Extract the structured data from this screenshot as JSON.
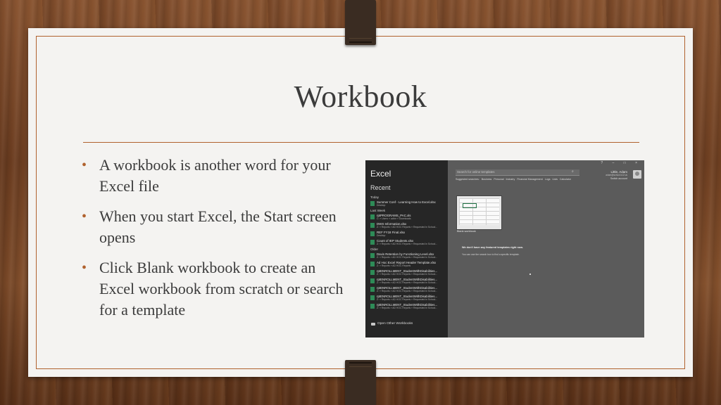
{
  "slide": {
    "title": "Workbook",
    "bullets": [
      "A workbook is another word for your Excel file",
      "When you start Excel, the Start screen opens",
      "Click Blank workbook to create an Excel workbook from scratch or search for a template"
    ],
    "accent_color": "#b0622e"
  },
  "excel": {
    "app_title": "Excel",
    "recent_label": "Recent",
    "groups": [
      {
        "label": "Today",
        "files": [
          {
            "name": "Summer Conf - Learning How to Excel.xlsx",
            "path": "Desktop"
          }
        ]
      },
      {
        "label": "Last Week",
        "files": [
          {
            "name": "rptPROGRAMS_PAC.xls",
            "path": "C: » Users » ucthe » Downloads"
          },
          {
            "name": "DWS Information.xlsx",
            "path": "Z: » Reports » AD HOC Reports » Requested in School..."
          },
          {
            "name": "REF FY18 Final.xlsx",
            "path": "Desktop"
          },
          {
            "name": "Count of IEP Students.xlsx",
            "path": "Z: » Reports » AD HOC Reports » Requested in School..."
          }
        ]
      },
      {
        "label": "Older",
        "files": [
          {
            "name": "Davis Retention by Functioning Level.xlsx",
            "path": "Z: » Reports » AD HOC Reports » Requested in School..."
          },
          {
            "name": "Ad Hoc Excel Report Header Template.xlsx",
            "path": "Z: » Reports » AD HOC Reports"
          },
          {
            "name": "rptENROLLMENT_StudentWithDisabilities...",
            "path": "Z: » Reports » AD HOC Reports » Requested in School..."
          },
          {
            "name": "rptENROLLMENT_StudentWithDisabilities...",
            "path": "Z: » Reports » AD HOC Reports » Requested in School..."
          },
          {
            "name": "rptENROLLMENT_StudentWithDisabilities...",
            "path": "Z: » Reports » AD HOC Reports » Requested in School..."
          },
          {
            "name": "rptENROLLMENT_StudentWithDisabilities...",
            "path": "Z: » Reports » AD HOC Reports » Requested in School..."
          },
          {
            "name": "rptENROLLMENT_StudentWithDisabilities...",
            "path": "Z: » Reports » AD HOC Reports » Requested in School..."
          }
        ]
      }
    ],
    "open_other": "Open Other Workbooks",
    "window_controls": "? – □ ×",
    "search_placeholder": "Search for online templates",
    "search_icon": "search-icon",
    "suggested": [
      "Suggested searches:",
      "Business",
      "Personal",
      "Industry",
      "Financial Management",
      "Logs",
      "Lists",
      "Calculator"
    ],
    "user": {
      "name": "Little, Adam",
      "email": "adam@school.k12.us",
      "switch": "Switch account"
    },
    "blank_workbook_label": "Blank workbook",
    "no_templates": "We don't have any featured templates right now.",
    "hint": "You can use the search box to find a specific template."
  }
}
